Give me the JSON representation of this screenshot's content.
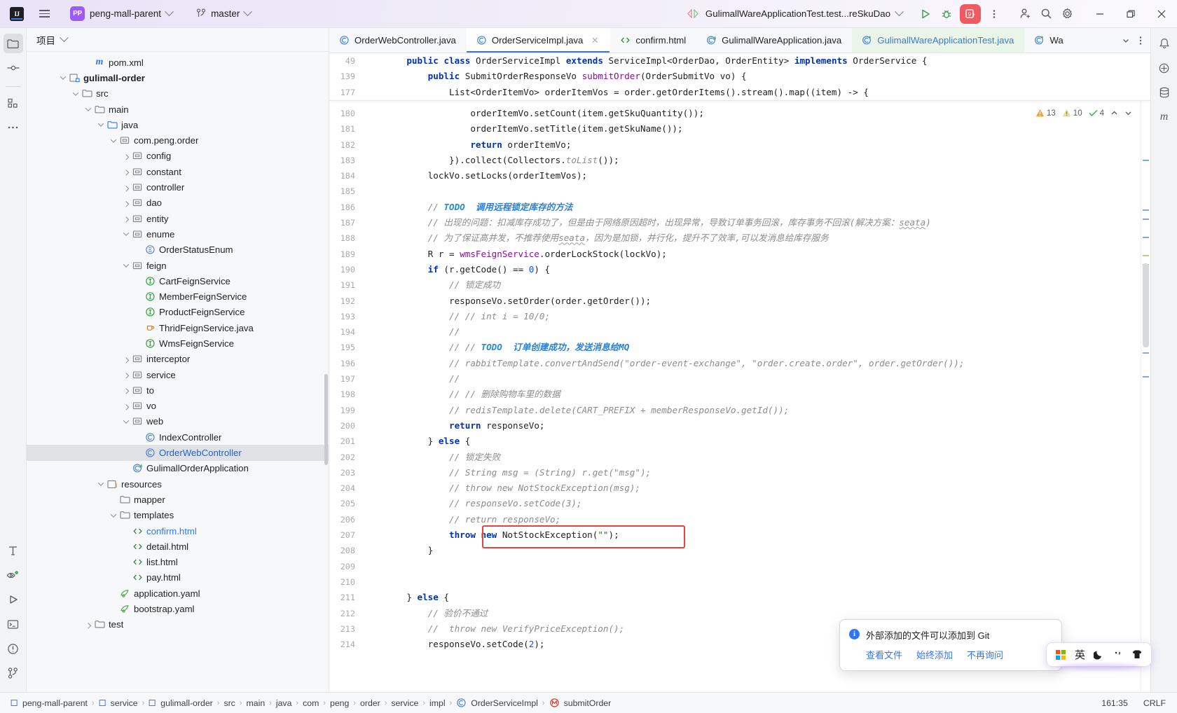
{
  "titlebar": {
    "ide_logo": "IJ",
    "menu_icon": "hamburger-menu-icon",
    "project_badge": "PP",
    "project_name": "peng-mall-parent",
    "branch_icon": "git-branch-icon",
    "branch_name": "master",
    "run_config": "GulimallWareApplicationTest.test...reSkuDao",
    "run_icon": "run-icon",
    "debug_icon": "debug-icon",
    "notifications_count": "9+",
    "more_icon": "more-vertical-icon",
    "share_icon": "add-user-icon",
    "search_icon": "search-icon",
    "settings_icon": "gear-icon",
    "minimize": "minimize-icon",
    "maximize": "maximize-icon",
    "close": "close-icon"
  },
  "left_rail": {
    "items": [
      {
        "name": "project-tool-icon",
        "selected": true
      },
      {
        "name": "commit-tool-icon",
        "selected": false
      },
      {
        "name": "structure-tool-icon",
        "selected": false
      },
      {
        "name": "more-tool-icon",
        "selected": false
      }
    ],
    "bottom_items": [
      {
        "name": "build-tool-icon"
      },
      {
        "name": "services-tool-icon"
      },
      {
        "name": "run-tool-icon"
      },
      {
        "name": "terminal-tool-icon"
      },
      {
        "name": "problems-tool-icon"
      },
      {
        "name": "version-control-tool-icon"
      }
    ]
  },
  "right_rail": {
    "items": [
      {
        "name": "notifications-icon"
      },
      {
        "name": "ai-assistant-icon"
      },
      {
        "name": "database-icon"
      },
      {
        "name": "maven-icon"
      }
    ]
  },
  "project_panel": {
    "title": "项目",
    "tree": [
      {
        "indent": 4,
        "arrow": "none",
        "icon": "maven-file-icon",
        "label": "pom.xml",
        "bold": false,
        "selected": false
      },
      {
        "indent": 2,
        "arrow": "down",
        "icon": "module-icon",
        "label": "gulimall-order",
        "bold": true,
        "selected": false
      },
      {
        "indent": 3,
        "arrow": "down",
        "icon": "folder-icon",
        "label": "src",
        "bold": false,
        "selected": false
      },
      {
        "indent": 4,
        "arrow": "down",
        "icon": "folder-icon",
        "label": "main",
        "bold": false,
        "selected": false
      },
      {
        "indent": 5,
        "arrow": "down",
        "icon": "source-folder-icon",
        "label": "java",
        "bold": false,
        "selected": false
      },
      {
        "indent": 6,
        "arrow": "down",
        "icon": "package-icon",
        "label": "com.peng.order",
        "bold": false,
        "selected": false
      },
      {
        "indent": 7,
        "arrow": "right",
        "icon": "package-icon",
        "label": "config",
        "bold": false,
        "selected": false
      },
      {
        "indent": 7,
        "arrow": "right",
        "icon": "package-icon",
        "label": "constant",
        "bold": false,
        "selected": false
      },
      {
        "indent": 7,
        "arrow": "right",
        "icon": "package-icon",
        "label": "controller",
        "bold": false,
        "selected": false
      },
      {
        "indent": 7,
        "arrow": "right",
        "icon": "package-icon",
        "label": "dao",
        "bold": false,
        "selected": false
      },
      {
        "indent": 7,
        "arrow": "right",
        "icon": "package-icon",
        "label": "entity",
        "bold": false,
        "selected": false
      },
      {
        "indent": 7,
        "arrow": "down",
        "icon": "package-icon",
        "label": "enume",
        "bold": false,
        "selected": false
      },
      {
        "indent": 8,
        "arrow": "none",
        "icon": "enum-icon",
        "label": "OrderStatusEnum",
        "bold": false,
        "selected": false
      },
      {
        "indent": 7,
        "arrow": "down",
        "icon": "package-icon",
        "label": "feign",
        "bold": false,
        "selected": false
      },
      {
        "indent": 8,
        "arrow": "none",
        "icon": "interface-icon",
        "label": "CartFeignService",
        "bold": false,
        "selected": false
      },
      {
        "indent": 8,
        "arrow": "none",
        "icon": "interface-icon",
        "label": "MemberFeignService",
        "bold": false,
        "selected": false
      },
      {
        "indent": 8,
        "arrow": "none",
        "icon": "interface-icon",
        "label": "ProductFeignService",
        "bold": false,
        "selected": false
      },
      {
        "indent": 8,
        "arrow": "none",
        "icon": "java-file-icon",
        "label": "ThridFeignService.java",
        "bold": false,
        "selected": false
      },
      {
        "indent": 8,
        "arrow": "none",
        "icon": "interface-icon",
        "label": "WmsFeignService",
        "bold": false,
        "selected": false
      },
      {
        "indent": 7,
        "arrow": "right",
        "icon": "package-icon",
        "label": "interceptor",
        "bold": false,
        "selected": false
      },
      {
        "indent": 7,
        "arrow": "right",
        "icon": "package-icon",
        "label": "service",
        "bold": false,
        "selected": false
      },
      {
        "indent": 7,
        "arrow": "right",
        "icon": "package-icon",
        "label": "to",
        "bold": false,
        "selected": false
      },
      {
        "indent": 7,
        "arrow": "right",
        "icon": "package-icon",
        "label": "vo",
        "bold": false,
        "selected": false
      },
      {
        "indent": 7,
        "arrow": "down",
        "icon": "package-icon",
        "label": "web",
        "bold": false,
        "selected": false
      },
      {
        "indent": 8,
        "arrow": "none",
        "icon": "class-icon",
        "label": "IndexController",
        "bold": false,
        "selected": false
      },
      {
        "indent": 8,
        "arrow": "none",
        "icon": "class-icon",
        "label": "OrderWebController",
        "bold": false,
        "selected": true
      },
      {
        "indent": 7,
        "arrow": "none",
        "icon": "spring-class-icon",
        "label": "GulimallOrderApplication",
        "bold": false,
        "selected": false
      },
      {
        "indent": 5,
        "arrow": "down",
        "icon": "resource-folder-icon",
        "label": "resources",
        "bold": false,
        "selected": false
      },
      {
        "indent": 6,
        "arrow": "none",
        "icon": "folder-icon",
        "label": "mapper",
        "bold": false,
        "selected": false
      },
      {
        "indent": 6,
        "arrow": "down",
        "icon": "folder-icon",
        "label": "templates",
        "bold": false,
        "selected": false
      },
      {
        "indent": 7,
        "arrow": "none",
        "icon": "html-file-icon",
        "label": "confirm.html",
        "bold": false,
        "selected": false,
        "link": true
      },
      {
        "indent": 7,
        "arrow": "none",
        "icon": "html-file-icon",
        "label": "detail.html",
        "bold": false,
        "selected": false
      },
      {
        "indent": 7,
        "arrow": "none",
        "icon": "html-file-icon",
        "label": "list.html",
        "bold": false,
        "selected": false
      },
      {
        "indent": 7,
        "arrow": "none",
        "icon": "html-file-icon",
        "label": "pay.html",
        "bold": false,
        "selected": false
      },
      {
        "indent": 6,
        "arrow": "none",
        "icon": "yaml-file-icon",
        "label": "application.yaml",
        "bold": false,
        "selected": false
      },
      {
        "indent": 6,
        "arrow": "none",
        "icon": "yaml-file-icon",
        "label": "bootstrap.yaml",
        "bold": false,
        "selected": false
      },
      {
        "indent": 4,
        "arrow": "right",
        "icon": "folder-icon",
        "label": "test",
        "bold": false,
        "selected": false
      }
    ]
  },
  "editor": {
    "tabs": [
      {
        "label": "OrderWebController.java",
        "icon": "class-icon",
        "active": false,
        "closable": false,
        "green": false
      },
      {
        "label": "OrderServiceImpl.java",
        "icon": "class-icon",
        "active": true,
        "closable": true,
        "green": false
      },
      {
        "label": "confirm.html",
        "icon": "html-file-icon",
        "active": false,
        "closable": false,
        "green": false
      },
      {
        "label": "GulimallWareApplication.java",
        "icon": "spring-class-icon",
        "active": false,
        "closable": false,
        "green": false
      },
      {
        "label": "GulimallWareApplicationTest.java",
        "icon": "test-class-icon",
        "active": false,
        "closable": false,
        "green": true
      },
      {
        "label": "Wa",
        "icon": "test-class-icon",
        "active": false,
        "closable": false,
        "green": false
      }
    ],
    "inspections": {
      "warnings": "13",
      "weak_warnings": "10",
      "ok_marks": "4",
      "warning_icon": "warning-triangle-icon",
      "weak_icon": "weak-warning-icon",
      "check_icon": "check-icon",
      "up_icon": "chevron-up-icon",
      "down_icon": "chevron-down-icon"
    },
    "sticky_lines": [
      {
        "num": "49",
        "html": "    <span class='kw'>public</span> <span class='kw'>class</span> OrderServiceImpl <span class='kw'>extends</span> ServiceImpl&lt;OrderDao, OrderEntity&gt; <span class='kw'>implements</span> OrderService {"
      },
      {
        "num": "139",
        "html": "        <span class='kw'>public</span> SubmitOrderResponseVo <span class='fld'>submitOrder</span>(OrderSubmitVo vo) {"
      },
      {
        "num": "177",
        "html": "            List&lt;OrderItemVo&gt; orderItemVos = order.getOrderItems().stream().map((item) -&gt; {"
      }
    ],
    "lines": [
      {
        "num": "180",
        "mark": "",
        "html": "                orderItemVo.setCount(item.getSkuQuantity());"
      },
      {
        "num": "181",
        "mark": "",
        "html": "                orderItemVo.setTitle(item.getSkuName());"
      },
      {
        "num": "182",
        "mark": "",
        "html": "                <span class='kw'>return</span> orderItemVo;"
      },
      {
        "num": "183",
        "mark": "",
        "html": "            }).collect(Collectors.<span class='cm'>toList</span>());"
      },
      {
        "num": "184",
        "mark": "",
        "html": "        lockVo.setLocks(orderItemVos);"
      },
      {
        "num": "185",
        "mark": "",
        "html": ""
      },
      {
        "num": "186",
        "mark": "",
        "html": "        <span class='cm'>// </span><span class='todo'>TODO</span><span class='todocn'>  调用远程锁定库存的方法</span>"
      },
      {
        "num": "187",
        "mark": "",
        "html": "        <span class='cmcn'>// 出现的问题：扣减库存成功了，但是由于网络原因超时，出现异常，导致订单事务回滚，库存事务不回滚(解决方案：<span class='sq'>seata</span>)</span>"
      },
      {
        "num": "188",
        "mark": "",
        "html": "        <span class='cmcn'>// 为了保证高并发，不推荐使用<span class='sq'>seata</span>，因为是加锁，并行化，提升不了效率,可以发消息给库存服务</span>"
      },
      {
        "num": "189",
        "mark": "",
        "html": "        R r = <span class='fld'>wmsFeignService</span>.orderLockStock(lockVo);"
      },
      {
        "num": "190",
        "mark": "",
        "html": "        <span class='kw'>if</span> (r.getCode() == <span class='num'>0</span>) {"
      },
      {
        "num": "191",
        "mark": "blue",
        "html": "            <span class='cm'>// </span><span class='cmcn'>锁定成功</span>"
      },
      {
        "num": "192",
        "mark": "blue",
        "html": "            responseVo.setOrder(order.getOrder());"
      },
      {
        "num": "193",
        "mark": "",
        "html": "            <span class='cm'>// // int i = 10/0;</span>"
      },
      {
        "num": "194",
        "mark": "",
        "html": "            <span class='cm'>//</span>"
      },
      {
        "num": "195",
        "mark": "",
        "html": "            <span class='cm'>// // </span><span class='todo'>TODO</span><span class='todocn'>  订单创建成功，发送消息给MQ</span>"
      },
      {
        "num": "196",
        "mark": "",
        "html": "            <span class='cm'>// rabbitTemplate.convertAndSend(\"order-event-exchange\", \"order.create.order\", order.getOrder());</span>"
      },
      {
        "num": "197",
        "mark": "",
        "html": "            <span class='cm'>//</span>"
      },
      {
        "num": "198",
        "mark": "",
        "html": "            <span class='cm'>// // </span><span class='cmcn'>删除购物车里的数据</span>"
      },
      {
        "num": "199",
        "mark": "",
        "html": "            <span class='cm'>// redisTemplate.delete(CART_PREFIX + memberResponseVo.getId());</span>"
      },
      {
        "num": "200",
        "mark": "",
        "html": "            <span class='kw'>return</span> responseVo;"
      },
      {
        "num": "201",
        "mark": "",
        "html": "        } <span class='kw'>else</span> {"
      },
      {
        "num": "202",
        "mark": "",
        "html": "            <span class='cm'>// </span><span class='cmcn'>锁定失败</span>"
      },
      {
        "num": "203",
        "mark": "blue",
        "html": "            <span class='cm'>// String msg = (String) r.get(\"msg\");</span>"
      },
      {
        "num": "204",
        "mark": "blue",
        "html": "            <span class='cm'>// throw new NotStockException(msg);</span>"
      },
      {
        "num": "205",
        "mark": "",
        "html": "            <span class='cm'>// responseVo.setCode(3);</span>"
      },
      {
        "num": "206",
        "mark": "",
        "html": "            <span class='cm'>// return responseVo;</span>"
      },
      {
        "num": "207",
        "mark": "green",
        "html": "            <span class='kw'>throw</span> <span class='kw'>new</span> NotStockException(<span class='str'>\"\"</span>);"
      },
      {
        "num": "208",
        "mark": "",
        "html": "        }"
      },
      {
        "num": "209",
        "mark": "",
        "html": ""
      },
      {
        "num": "210",
        "mark": "",
        "html": ""
      },
      {
        "num": "211",
        "mark": "",
        "html": "    } <span class='kw'>else</span> {"
      },
      {
        "num": "212",
        "mark": "",
        "html": "        <span class='cm'>// </span><span class='cmcn'>验价不通过</span>"
      },
      {
        "num": "213",
        "mark": "",
        "html": "        <span class='cm'>//  throw new VerifyPriceException();</span>"
      },
      {
        "num": "214",
        "mark": "blue",
        "html": "        responseVo.setCode(<span class='num'>2</span>);"
      }
    ]
  },
  "notification": {
    "icon": "info-icon",
    "title": "外部添加的文件可以添加到 Git",
    "actions": [
      "查看文件",
      "始终添加",
      "不再询问"
    ]
  },
  "ime": {
    "windows_icon": "windows-logo-icon",
    "lang": "英",
    "moon_icon": "moon-icon",
    "punct_icon": "punctuation-icon",
    "skin_icon": "skin-icon"
  },
  "status_bar": {
    "breadcrumbs": [
      {
        "label": "peng-mall-parent",
        "icon": "module-icon"
      },
      {
        "label": "service",
        "icon": "module-icon"
      },
      {
        "label": "gulimall-order",
        "icon": "module-icon"
      },
      {
        "label": "src",
        "icon": "none"
      },
      {
        "label": "main",
        "icon": "none"
      },
      {
        "label": "java",
        "icon": "none"
      },
      {
        "label": "com",
        "icon": "none"
      },
      {
        "label": "peng",
        "icon": "none"
      },
      {
        "label": "order",
        "icon": "none"
      },
      {
        "label": "service",
        "icon": "none"
      },
      {
        "label": "impl",
        "icon": "none"
      },
      {
        "label": "OrderServiceImpl",
        "icon": "class-icon"
      },
      {
        "label": "submitOrder",
        "icon": "method-icon"
      }
    ],
    "caret_position": "161:35",
    "line_separator": "CRLF"
  },
  "colors": {
    "accent_blue": "#3574f0",
    "keyword_blue": "#0033b3",
    "string_green": "#067d17",
    "comment_gray": "#8c8c8c",
    "error_red": "#e8403a",
    "purple_brand": "#9c5bf2",
    "tab_green_bg": "#eaf5ea"
  }
}
